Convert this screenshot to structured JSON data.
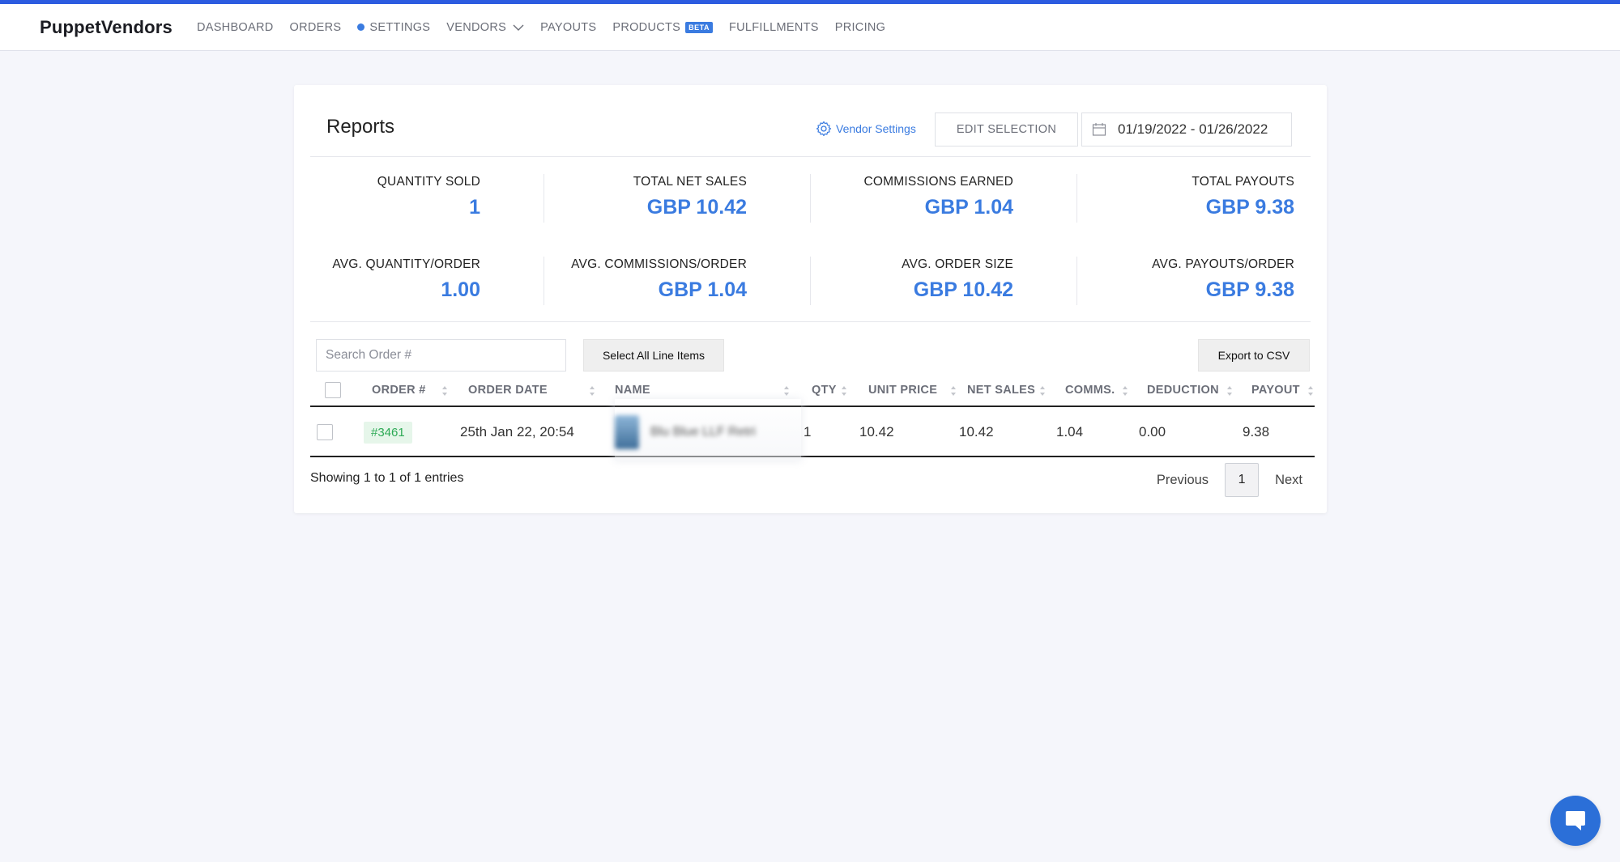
{
  "app": {
    "brand": "PuppetVendors",
    "accent": "#3a7be0",
    "topbar_stripe": "#2c5be0"
  },
  "nav": {
    "items": [
      {
        "label": "DASHBOARD"
      },
      {
        "label": "ORDERS"
      },
      {
        "label": "SETTINGS",
        "indicator": "blue-dot"
      },
      {
        "label": "VENDORS",
        "icon": "chevron-down-icon"
      },
      {
        "label": "PAYOUTS"
      },
      {
        "label": "PRODUCTS",
        "badge": "BETA"
      },
      {
        "label": "FULFILLMENTS"
      },
      {
        "label": "PRICING"
      }
    ]
  },
  "reports": {
    "title": "Reports",
    "vendor_settings": "Vendor Settings",
    "edit_selection": "EDIT SELECTION",
    "date_range": "01/19/2022 - 01/26/2022"
  },
  "stats": [
    {
      "label": "QUANTITY SOLD",
      "value": "1"
    },
    {
      "label": "TOTAL NET SALES",
      "value": "GBP 10.42"
    },
    {
      "label": "COMMISSIONS EARNED",
      "value": "GBP 1.04"
    },
    {
      "label": "TOTAL PAYOUTS",
      "value": "GBP 9.38"
    },
    {
      "label": "AVG. QUANTITY/ORDER",
      "value": "1.00"
    },
    {
      "label": "AVG. COMMISSIONS/ORDER",
      "value": "GBP 1.04"
    },
    {
      "label": "AVG. ORDER SIZE",
      "value": "GBP 10.42"
    },
    {
      "label": "AVG. PAYOUTS/ORDER",
      "value": "GBP 9.38"
    }
  ],
  "table": {
    "search_placeholder": "Search Order #",
    "select_all_label": "Select All Line Items",
    "export_label": "Export to CSV",
    "columns": [
      "ORDER #",
      "ORDER DATE",
      "NAME",
      "QTY",
      "UNIT PRICE",
      "NET SALES",
      "COMMS.",
      "DEDUCTION",
      "PAYOUT"
    ],
    "rows": [
      {
        "order": "#3461",
        "date": "25th Jan 22, 20:54",
        "name": "Blu Blue LLF Retri",
        "qty": "1",
        "unit_price": "10.42",
        "net_sales": "10.42",
        "comms": "1.04",
        "deduction": "0.00",
        "payout": "9.38"
      }
    ],
    "info": "Showing 1 to 1 of 1 entries",
    "pager": {
      "previous": "Previous",
      "page": "1",
      "next": "Next"
    }
  },
  "chat": {
    "icon": "chat-bubble-icon"
  }
}
